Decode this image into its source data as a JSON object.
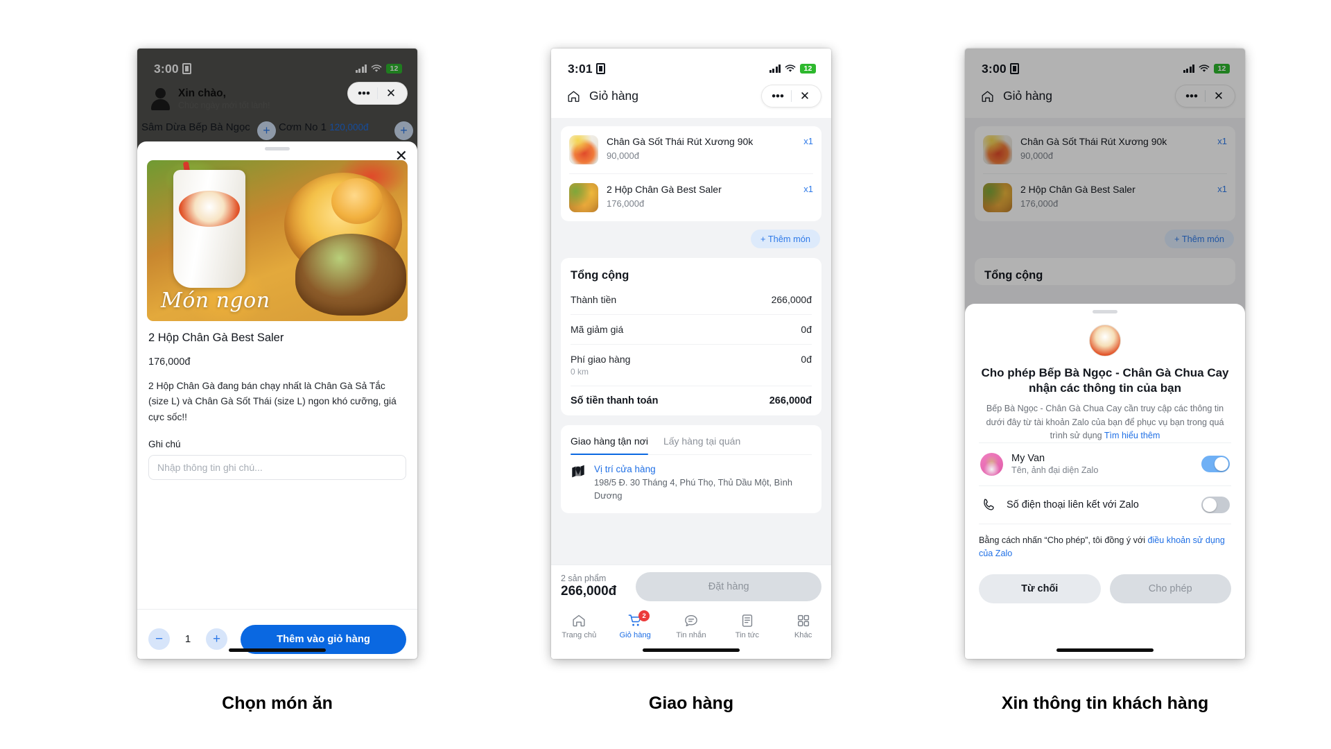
{
  "screens": [
    {
      "caption": "Chọn món ăn",
      "status": {
        "time": "3:00",
        "battery": "12"
      },
      "background": {
        "greeting_title": "Xin chào,",
        "greeting_sub": "Chúc ngày mới tốt lành!",
        "cards": [
          {
            "name": "Sâm Dừa Bếp Bà Ngọc",
            "price": ""
          },
          {
            "name": "Cơm No 1",
            "price": "120,000đ"
          }
        ]
      },
      "sheet": {
        "close_icon": "close-icon",
        "image_caption": "Món ngon",
        "product_title": "2 Hộp Chân Gà Best Saler",
        "product_price": "176,000đ",
        "product_desc": "2 Hộp Chân Gà đang bán chạy nhất là Chân Gà Sả Tắc (size L) và Chân Gà Sốt Thái (size L) ngon khó cưỡng, giá cực sốc!!",
        "note_label": "Ghi chú",
        "note_placeholder": "Nhập thông tin ghi chú...",
        "note_value": "",
        "minus_label": "−",
        "quantity": "1",
        "plus_label": "+",
        "cta_label": "Thêm vào giỏ hàng"
      }
    },
    {
      "caption": "Giao hàng",
      "status": {
        "time": "3:01",
        "battery": "12"
      },
      "header": {
        "title": "Giỏ hàng",
        "home_icon": "home-icon"
      },
      "cart_items": [
        {
          "name": "Chân Gà Sốt Thái Rút Xương 90k",
          "price": "90,000đ",
          "qty": "x1"
        },
        {
          "name": "2 Hộp Chân Gà Best Saler",
          "price": "176,000đ",
          "qty": "x1"
        }
      ],
      "add_more_label": "+ Thêm món",
      "totals": {
        "title": "Tổng cộng",
        "rows": [
          {
            "label": "Thành tiền",
            "sub": "",
            "value": "266,000đ"
          },
          {
            "label": "Mã giảm giá",
            "sub": "",
            "value": "0đ"
          },
          {
            "label": "Phí giao hàng",
            "sub": "0 km",
            "value": "0đ"
          },
          {
            "label": "Số tiền thanh toán",
            "sub": "",
            "value": "266,000đ"
          }
        ]
      },
      "delivery": {
        "tabs": [
          "Giao hàng tận nơi",
          "Lấy hàng tại quán"
        ],
        "active_tab": "Giao hàng tận nơi",
        "store_link": "Vị trí cửa hàng",
        "store_address": "198/5 Đ. 30 Tháng 4, Phú Thọ, Thủ Dầu Một, Bình Dương"
      },
      "checkout": {
        "count": "2 sản phẩm",
        "total": "266,000đ",
        "button": "Đặt hàng"
      },
      "tabbar": [
        {
          "label": "Trang chủ",
          "icon": "home-icon",
          "badge": ""
        },
        {
          "label": "Giỏ hàng",
          "icon": "cart-icon",
          "badge": "2"
        },
        {
          "label": "Tin nhắn",
          "icon": "message-icon",
          "badge": ""
        },
        {
          "label": "Tin tức",
          "icon": "news-icon",
          "badge": ""
        },
        {
          "label": "Khác",
          "icon": "grid-icon",
          "badge": ""
        }
      ]
    },
    {
      "caption": "Xin thông tin khách hàng",
      "status": {
        "time": "3:00",
        "battery": "12"
      },
      "header": {
        "title": "Giỏ hàng",
        "home_icon": "home-icon"
      },
      "cart_items": [
        {
          "name": "Chân Gà Sốt Thái Rút Xương 90k",
          "price": "90,000đ",
          "qty": "x1"
        },
        {
          "name": "2 Hộp Chân Gà Best Saler",
          "price": "176,000đ",
          "qty": "x1"
        }
      ],
      "add_more_label": "+ Thêm món",
      "totals_title": "Tổng cộng",
      "permission": {
        "logo_icon": "brand-logo-icon",
        "title": "Cho phép Bếp Bà Ngọc - Chân Gà Chua Cay nhận các thông tin của bạn",
        "desc_prefix": "Bếp Bà Ngọc - Chân Gà Chua Cay cần truy cập các thông tin dưới đây từ tài khoản Zalo của bạn để phục vụ bạn trong quá trình sử dụng ",
        "desc_link": "Tìm hiểu thêm",
        "rows": [
          {
            "name": "My Van",
            "sub": "Tên, ảnh đại diện Zalo",
            "toggle": "on",
            "icon": "avatar"
          },
          {
            "name": "Số điện thoại liên kết với Zalo",
            "sub": "",
            "toggle": "off",
            "icon": "phone-icon"
          }
        ],
        "legal_prefix": "Bằng cách nhấn “Cho phép”, tôi đồng ý với ",
        "legal_link": "điều khoản sử dụng của Zalo",
        "deny_label": "Từ chối",
        "allow_label": "Cho phép"
      }
    }
  ],
  "colors": {
    "primary_blue": "#0a68e1",
    "link_blue": "#1f6fe5",
    "badge_red": "#ec3b3b",
    "battery_green": "#2eb82e"
  }
}
